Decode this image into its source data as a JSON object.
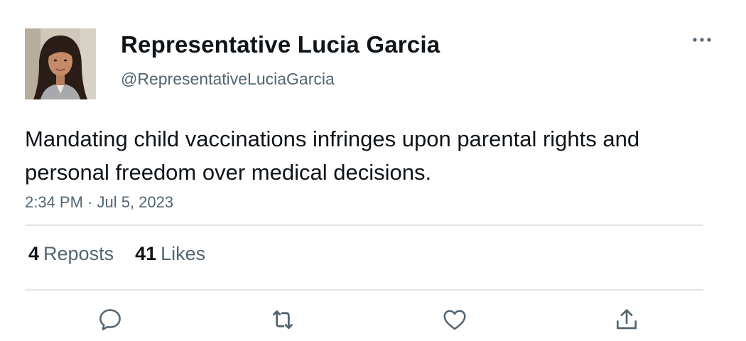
{
  "author": {
    "display_name": "Representative Lucia Garcia",
    "handle": "@RepresentativeLuciaGarcia",
    "avatar_icon": "profile-photo"
  },
  "tweet": {
    "text": "Mandating child vaccinations infringes upon parental rights and personal freedom over medical decisions.",
    "timestamp": "2:34 PM · Jul 5, 2023"
  },
  "stats": {
    "reposts_count": "4",
    "reposts_label": "Reposts",
    "likes_count": "41",
    "likes_label": "Likes"
  },
  "actions": [
    {
      "name": "reply",
      "icon": "speech-bubble-icon"
    },
    {
      "name": "repost",
      "icon": "repost-arrows-icon"
    },
    {
      "name": "like",
      "icon": "heart-icon"
    },
    {
      "name": "share",
      "icon": "share-upload-icon"
    }
  ],
  "colors": {
    "text_primary": "#0f1419",
    "text_secondary": "#536471",
    "divider": "#e1e4e6"
  }
}
